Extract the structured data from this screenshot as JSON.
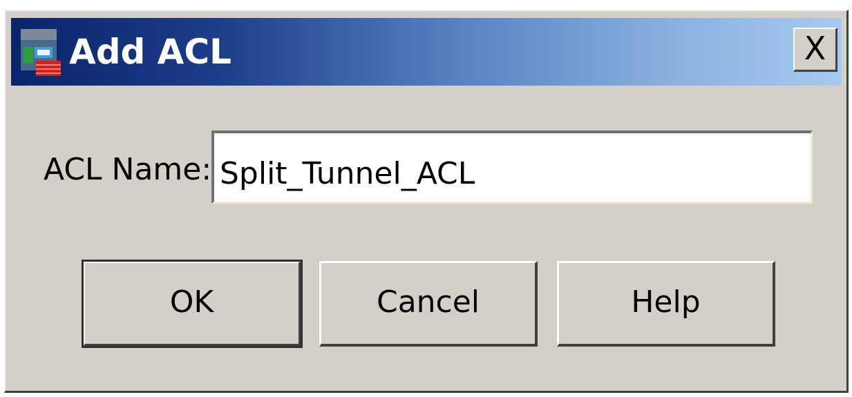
{
  "window": {
    "title": "Add ACL",
    "icon": "acl-app-icon",
    "close_label": "X",
    "titlebar_gradient": [
      "#0a246a",
      "#a6caf0"
    ]
  },
  "form": {
    "acl_name_label": "ACL Name:",
    "acl_name_value": "Split_Tunnel_ACL"
  },
  "buttons": {
    "ok_label": "OK",
    "cancel_label": "Cancel",
    "help_label": "Help"
  }
}
